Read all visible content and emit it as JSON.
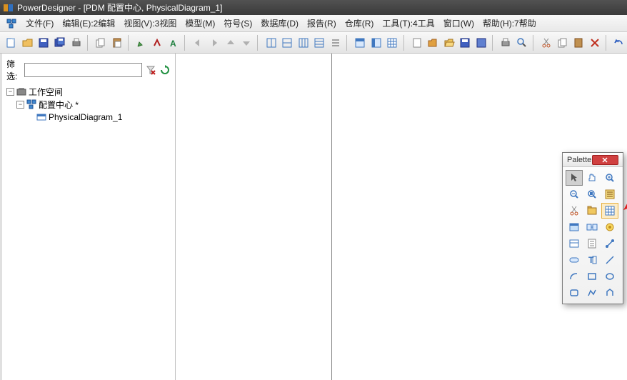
{
  "window": {
    "title": "PowerDesigner - [PDM 配置中心, PhysicalDiagram_1]"
  },
  "menu": {
    "items": [
      "文件(F)",
      "编辑(E):2编辑",
      "视图(V):3视图",
      "模型(M)",
      "符号(S)",
      "数据库(D)",
      "报告(R)",
      "仓库(R)",
      "工具(T):4工具",
      "窗口(W)",
      "帮助(H):7帮助"
    ]
  },
  "filter": {
    "label": "筛选:",
    "value": ""
  },
  "tree": {
    "root": "工作空间",
    "child1": "配置中心 *",
    "child2": "PhysicalDiagram_1"
  },
  "palette": {
    "title": "Palette"
  }
}
